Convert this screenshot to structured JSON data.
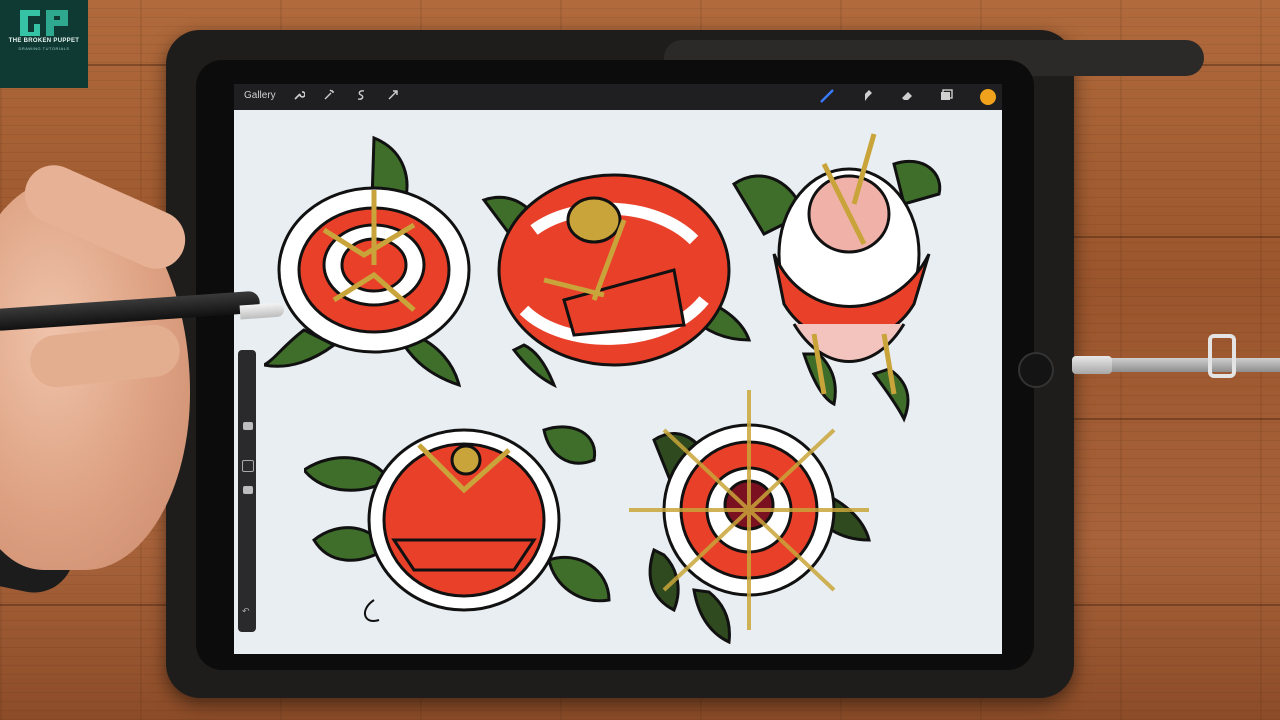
{
  "logo": {
    "title": "THE BROKEN PUPPET",
    "subtitle": "DRAWING TUTORIALS"
  },
  "toolbar": {
    "gallery_label": "Gallery",
    "left_tools": [
      "wrench-icon",
      "magic-wand-icon",
      "selection-icon",
      "transform-arrow-icon"
    ],
    "right_tools": [
      "brush-icon",
      "smudge-icon",
      "eraser-icon",
      "layers-icon"
    ]
  },
  "colors": {
    "active_color": "#f0a21c",
    "petal_red": "#e9402a",
    "leaf_green": "#3f6e2a",
    "thorn_gold": "#c9a43a",
    "outline": "#111111"
  },
  "canvas_content": "traditional tattoo rose flash sheet"
}
